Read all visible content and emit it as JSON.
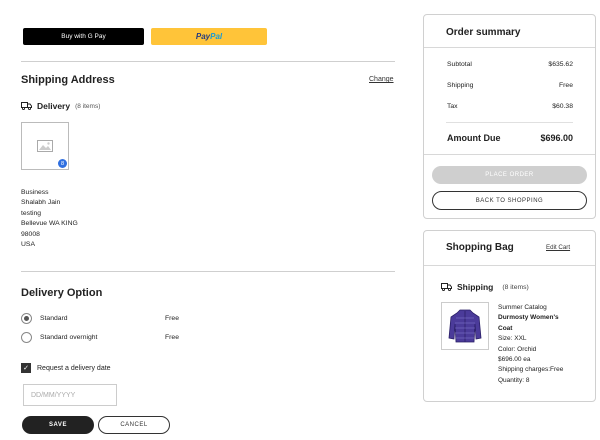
{
  "payment": {
    "gpay_label": "Buy with G Pay",
    "paypal_part1": "Pay",
    "paypal_part2": "Pal"
  },
  "shipping_address": {
    "title": "Shipping Address",
    "change_label": "Change",
    "delivery_label": "Delivery",
    "delivery_count": "(8 items)",
    "thumb_badge": "8",
    "address_lines": [
      "Business",
      "Shalabh Jain",
      "testing",
      "Bellevue WA KING",
      "98008",
      "USA"
    ]
  },
  "delivery_option": {
    "title": "Delivery Option",
    "options": [
      {
        "label": "Standard",
        "price": "Free",
        "checked": true
      },
      {
        "label": "Standard overnight",
        "price": "Free",
        "checked": false
      }
    ],
    "request_date_label": "Request a delivery date",
    "date_placeholder": "DD/MM/YYYY",
    "save_label": "SAVE",
    "cancel_label": "CANCEL"
  },
  "order_summary": {
    "title": "Order summary",
    "rows": [
      {
        "label": "Subtotal",
        "value": "$635.62"
      },
      {
        "label": "Shipping",
        "value": "Free"
      },
      {
        "label": "Tax",
        "value": "$60.38"
      }
    ],
    "total_label": "Amount Due",
    "total_value": "$696.00",
    "place_order_label": "PLACE ORDER",
    "back_label": "BACK TO SHOPPING"
  },
  "shopping_bag": {
    "title": "Shopping Bag",
    "edit_label": "Edit Cart",
    "shipping_label": "Shipping",
    "shipping_count": "(8 items)",
    "product": {
      "catalog": "Summer Catalog",
      "name_line1": "Durmosty Women's",
      "name_line2": "Coat",
      "size": "Size: XXL",
      "color": "Color: Orchid",
      "price": "$696.00 ea",
      "shipping_charges": "Shipping charges:Free",
      "quantity": "Quantity:  8"
    }
  },
  "colors": {
    "paypal_yellow": "#ffc439",
    "gpay_black": "#000000",
    "badge_blue": "#2f6fe0",
    "coat_purple": "#4b3b9a"
  }
}
